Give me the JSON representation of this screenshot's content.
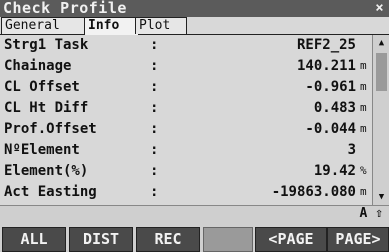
{
  "window": {
    "title": "Check Profile",
    "close_symbol": "×"
  },
  "tabs": [
    {
      "label": "General"
    },
    {
      "label": "Info"
    },
    {
      "label": "Plot"
    }
  ],
  "rows": [
    {
      "label": "Strg1 Task",
      "value": "REF2_25",
      "unit": ""
    },
    {
      "label": "Chainage",
      "value": "140.211",
      "unit": "m"
    },
    {
      "label": "CL Offset",
      "value": "-0.961",
      "unit": "m"
    },
    {
      "label": "CL Ht Diff",
      "value": "0.483",
      "unit": "m"
    },
    {
      "label": "Prof.Offset",
      "value": "-0.044",
      "unit": "m"
    },
    {
      "label": "NºElement",
      "value": "3",
      "unit": ""
    },
    {
      "label": "Element(%)",
      "value": "19.42",
      "unit": "%"
    },
    {
      "label": "Act Easting",
      "value": "-19863.080",
      "unit": "m"
    }
  ],
  "colon": ":",
  "scrollbar": {
    "up": "▲",
    "down": "▼"
  },
  "status": {
    "indicator": "A ⇧"
  },
  "softkeys": {
    "f1": "ALL",
    "f2": "DIST",
    "f3": "REC",
    "f4": "",
    "f5": "<PAGE",
    "f6": "PAGE>"
  }
}
